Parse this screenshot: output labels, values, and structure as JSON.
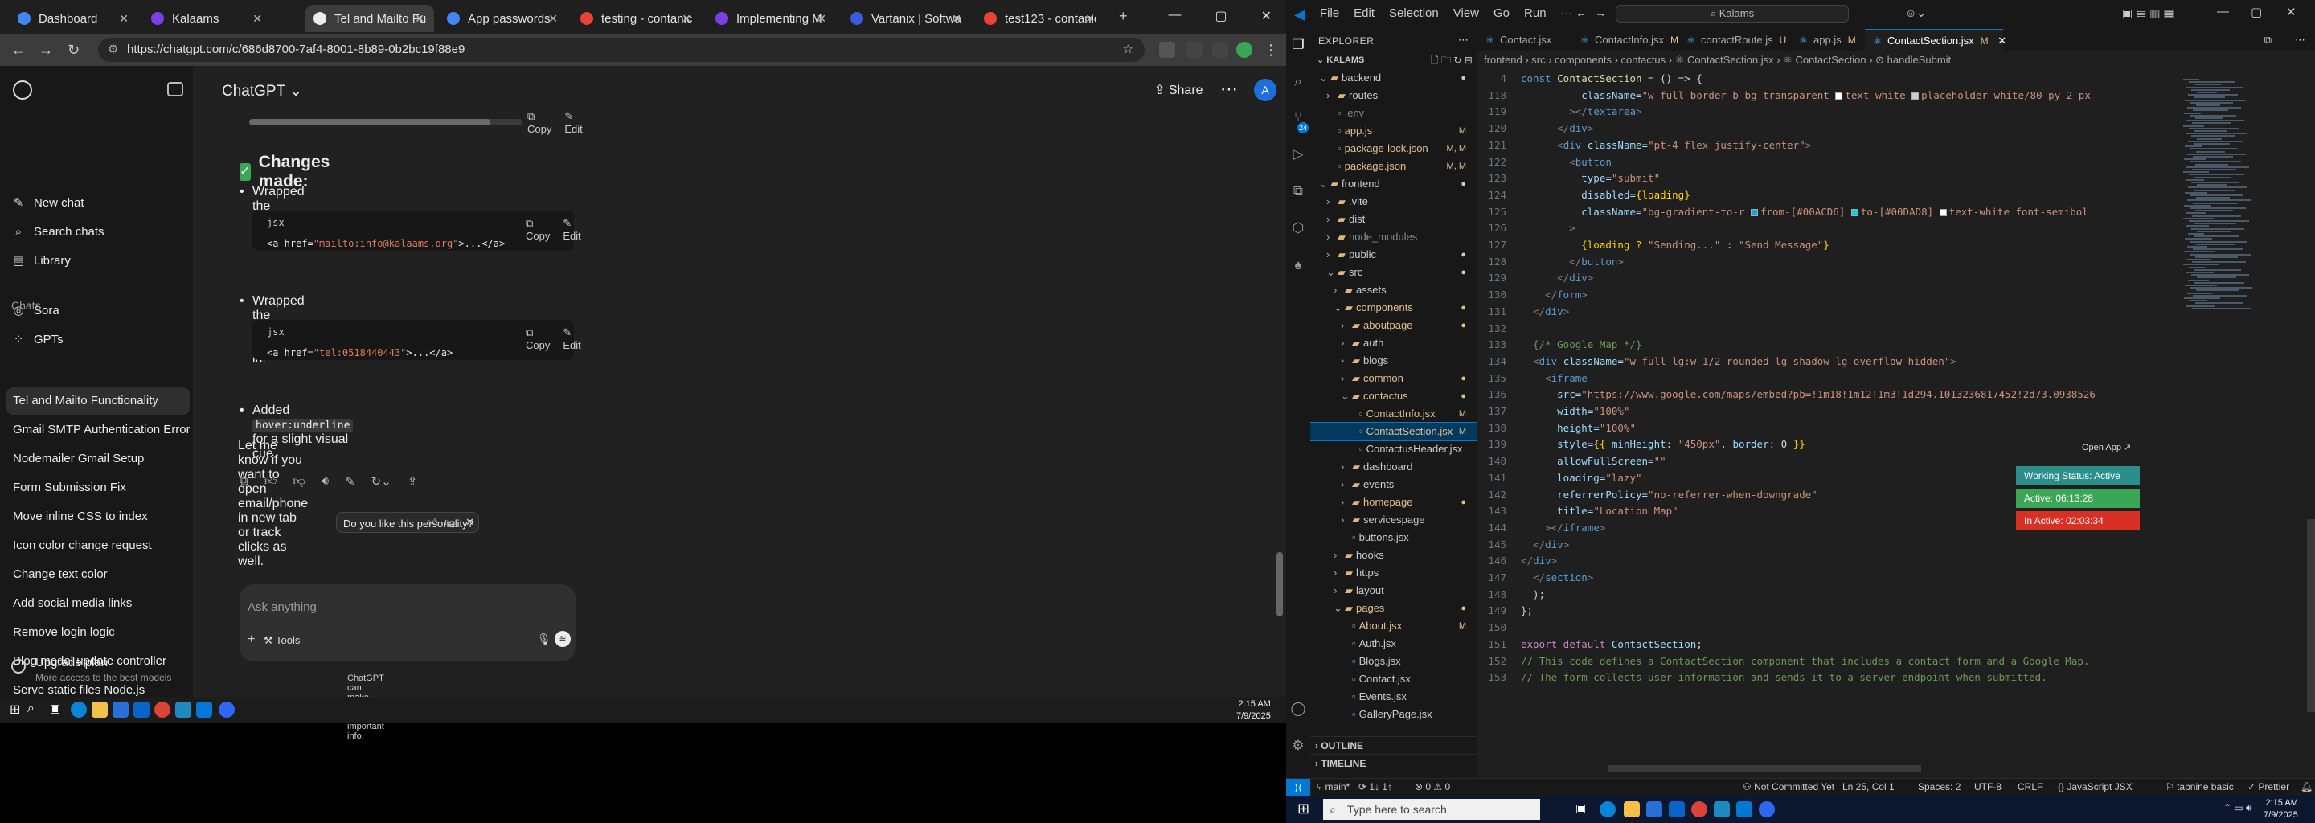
{
  "browser": {
    "tabs": [
      {
        "label": "Dashboard",
        "color": "#4285f4"
      },
      {
        "label": "Kalaams",
        "color": "#7b3fe4"
      },
      {
        "label": "Tel and Mailto Fu",
        "color": "#ececec"
      },
      {
        "label": "App passwords",
        "color": "#4285f4"
      },
      {
        "label": "testing - contanic",
        "color": "#ea4335"
      },
      {
        "label": "Implementing M",
        "color": "#7b3fe4"
      },
      {
        "label": "Vartanix | Softwa",
        "color": "#3b5bdb"
      },
      {
        "label": "test123 - contanic",
        "color": "#ea4335"
      }
    ],
    "url": "https://chatgpt.com/c/686d8700-7af4-8001-8b89-0b2bc19f88e9"
  },
  "chatgpt": {
    "sidebar": {
      "items": [
        {
          "icon": "✎",
          "label": "New chat"
        },
        {
          "icon": "⌕",
          "label": "Search chats"
        },
        {
          "icon": "▤",
          "label": "Library"
        },
        {
          "icon": "◎",
          "label": "Sora"
        },
        {
          "icon": "⁘",
          "label": "GPTs"
        }
      ],
      "chats_label": "Chats",
      "chats": [
        "Tel and Mailto Functionality",
        "Gmail SMTP Authentication Error",
        "Nodemailer Gmail Setup",
        "Form Submission Fix",
        "Move inline CSS to index",
        "Icon color change request",
        "Change text color",
        "Add social media links",
        "Remove login logic",
        "Blog model update controller",
        "Serve static files Node.js"
      ],
      "upgrade_title": "Upgrade plan",
      "upgrade_sub": "More access to the best models"
    },
    "header": {
      "model": "ChatGPT ⌄",
      "share": "Share",
      "avatar": "A"
    },
    "message": {
      "copy": "Copy",
      "edit": "Edit",
      "heading": "Changes made:",
      "bullet1": "Wrapped the email in:",
      "code1_lang": "jsx",
      "code1_pre": "<a href=",
      "code1_str": "\"mailto:info@kalaams.org\"",
      "code1_post": ">...</a>",
      "bullet2": "Wrapped the phone number in:",
      "code2_lang": "jsx",
      "code2_pre": "<a href=",
      "code2_str": "\"tel:0518440443\"",
      "code2_post": ">...</a>",
      "bullet3_pre": "Added",
      "bullet3_code": "hover:underline",
      "bullet3_post": "for a slight visual cue.",
      "closing": "Let me know if you want to open email/phone in new tab or track clicks as well."
    },
    "feedback_q": "Do you like this personality?",
    "composer": {
      "placeholder": "Ask anything",
      "tools": "Tools"
    },
    "disclaimer": "ChatGPT can make mistakes. Check important info."
  },
  "taskbar_left": {
    "time": "2:15 AM",
    "date": "7/9/2025"
  },
  "vscode": {
    "menu": [
      "File",
      "Edit",
      "Selection",
      "View",
      "Go",
      "Run",
      "···"
    ],
    "search": "Kalams",
    "explorer_title": "EXPLORER",
    "root": "KALAMS",
    "tree": [
      {
        "label": "backend",
        "indent": 1,
        "folder": true,
        "open": true,
        "color": "#ccc",
        "dec": "●"
      },
      {
        "label": "routes",
        "indent": 2,
        "folder": true,
        "open": false,
        "color": "#ccc",
        "dec": ""
      },
      {
        "label": ".env",
        "indent": 2,
        "folder": false,
        "color": "#8a8a8a",
        "dec": ""
      },
      {
        "label": "app.js",
        "indent": 2,
        "folder": false,
        "color": "#e2c08d",
        "dec": "M"
      },
      {
        "label": "package-lock.json",
        "indent": 2,
        "folder": false,
        "color": "#e2c08d",
        "dec": "M, M"
      },
      {
        "label": "package.json",
        "indent": 2,
        "folder": false,
        "color": "#e2c08d",
        "dec": "M, M"
      },
      {
        "label": "frontend",
        "indent": 1,
        "folder": true,
        "open": true,
        "color": "#ccc",
        "dec": "●"
      },
      {
        "label": ".vite",
        "indent": 2,
        "folder": true,
        "open": false,
        "color": "#ccc",
        "dec": ""
      },
      {
        "label": "dist",
        "indent": 2,
        "folder": true,
        "open": false,
        "color": "#ccc",
        "dec": ""
      },
      {
        "label": "node_modules",
        "indent": 2,
        "folder": true,
        "open": false,
        "color": "#8a8a8a",
        "dec": ""
      },
      {
        "label": "public",
        "indent": 2,
        "folder": true,
        "open": false,
        "color": "#ccc",
        "dec": "●"
      },
      {
        "label": "src",
        "indent": 2,
        "folder": true,
        "open": true,
        "color": "#ccc",
        "dec": "●"
      },
      {
        "label": "assets",
        "indent": 3,
        "folder": true,
        "open": false,
        "color": "#ccc",
        "dec": ""
      },
      {
        "label": "components",
        "indent": 3,
        "folder": true,
        "open": true,
        "color": "#e2c08d",
        "dec": "●"
      },
      {
        "label": "aboutpage",
        "indent": 4,
        "folder": true,
        "open": false,
        "color": "#e2c08d",
        "dec": "●"
      },
      {
        "label": "auth",
        "indent": 4,
        "folder": true,
        "open": false,
        "color": "#ccc",
        "dec": ""
      },
      {
        "label": "blogs",
        "indent": 4,
        "folder": true,
        "open": false,
        "color": "#ccc",
        "dec": ""
      },
      {
        "label": "common",
        "indent": 4,
        "folder": true,
        "open": false,
        "color": "#e2c08d",
        "dec": "●"
      },
      {
        "label": "contactus",
        "indent": 4,
        "folder": true,
        "open": true,
        "color": "#e2c08d",
        "dec": "●"
      },
      {
        "label": "ContactInfo.jsx",
        "indent": 5,
        "folder": false,
        "color": "#e2c08d",
        "dec": "M"
      },
      {
        "label": "ContactSection.jsx",
        "indent": 5,
        "folder": false,
        "color": "#e2c08d",
        "dec": "M",
        "sel": true
      },
      {
        "label": "ContactusHeader.jsx",
        "indent": 5,
        "folder": false,
        "color": "#ccc",
        "dec": ""
      },
      {
        "label": "dashboard",
        "indent": 4,
        "folder": true,
        "open": false,
        "color": "#ccc",
        "dec": ""
      },
      {
        "label": "events",
        "indent": 4,
        "folder": true,
        "open": false,
        "color": "#ccc",
        "dec": ""
      },
      {
        "label": "homepage",
        "indent": 4,
        "folder": true,
        "open": false,
        "color": "#e2c08d",
        "dec": "●"
      },
      {
        "label": "servicespage",
        "indent": 4,
        "folder": true,
        "open": false,
        "color": "#ccc",
        "dec": ""
      },
      {
        "label": "buttons.jsx",
        "indent": 4,
        "folder": false,
        "color": "#ccc",
        "dec": ""
      },
      {
        "label": "hooks",
        "indent": 3,
        "folder": true,
        "open": false,
        "color": "#ccc",
        "dec": ""
      },
      {
        "label": "https",
        "indent": 3,
        "folder": true,
        "open": false,
        "color": "#ccc",
        "dec": ""
      },
      {
        "label": "layout",
        "indent": 3,
        "folder": true,
        "open": false,
        "color": "#ccc",
        "dec": ""
      },
      {
        "label": "pages",
        "indent": 3,
        "folder": true,
        "open": true,
        "color": "#e2c08d",
        "dec": "●"
      },
      {
        "label": "About.jsx",
        "indent": 4,
        "folder": false,
        "color": "#e2c08d",
        "dec": "M"
      },
      {
        "label": "Auth.jsx",
        "indent": 4,
        "folder": false,
        "color": "#ccc",
        "dec": ""
      },
      {
        "label": "Blogs.jsx",
        "indent": 4,
        "folder": false,
        "color": "#ccc",
        "dec": ""
      },
      {
        "label": "Contact.jsx",
        "indent": 4,
        "folder": false,
        "color": "#ccc",
        "dec": ""
      },
      {
        "label": "Events.jsx",
        "indent": 4,
        "folder": false,
        "color": "#ccc",
        "dec": ""
      },
      {
        "label": "GalleryPage.jsx",
        "indent": 4,
        "folder": false,
        "color": "#ccc",
        "dec": ""
      }
    ],
    "outline": "OUTLINE",
    "timeline": "TIMELINE",
    "editor_tabs": [
      {
        "label": "Contact.jsx",
        "mod": ""
      },
      {
        "label": "ContactInfo.jsx",
        "mod": "M"
      },
      {
        "label": "contactRoute.js",
        "mod": "U"
      },
      {
        "label": "app.js",
        "mod": "M"
      },
      {
        "label": "ContactSection.jsx",
        "mod": "M",
        "active": true
      }
    ],
    "breadcrumb": "frontend  ›  src  ›  components  ›  contactus  ›  ⚛ ContactSection.jsx  ›  ⚛ ContactSection  ›  ⊙ handleSubmit",
    "lines": [
      [
        [
          "4",
          "ln"
        ],
        [
          "const ",
          "k"
        ],
        [
          "ContactSection",
          "f"
        ],
        [
          " = () => {",
          "w"
        ]
      ],
      [
        [
          "118",
          "ln"
        ],
        [
          "          className=",
          "at"
        ],
        [
          "\"w-full border-b bg-transparent ",
          "s"
        ],
        [
          "▢",
          "sw:#ffffff"
        ],
        [
          "text-white ",
          "s"
        ],
        [
          "▢",
          "sw:#cccccc"
        ],
        [
          "placeholder-white/80 py-2 px",
          "s"
        ]
      ],
      [
        [
          "119",
          "ln"
        ],
        [
          "        ></",
          "p"
        ],
        [
          "textarea",
          "k"
        ],
        [
          ">",
          "p"
        ]
      ],
      [
        [
          "120",
          "ln"
        ],
        [
          "      </",
          "p"
        ],
        [
          "div",
          "k"
        ],
        [
          ">",
          "p"
        ]
      ],
      [
        [
          "121",
          "ln"
        ],
        [
          "      <",
          "p"
        ],
        [
          "div ",
          "k"
        ],
        [
          "className=",
          "at"
        ],
        [
          "\"pt-4 flex justify-center\"",
          "s"
        ],
        [
          ">",
          "p"
        ]
      ],
      [
        [
          "122",
          "ln"
        ],
        [
          "        <",
          "p"
        ],
        [
          "button",
          "k"
        ]
      ],
      [
        [
          "123",
          "ln"
        ],
        [
          "          type=",
          "at"
        ],
        [
          "\"submit\"",
          "s"
        ]
      ],
      [
        [
          "124",
          "ln"
        ],
        [
          "          disabled=",
          "at"
        ],
        [
          "{loading}",
          "b"
        ]
      ],
      [
        [
          "125",
          "ln"
        ],
        [
          "          className=",
          "at"
        ],
        [
          "\"bg-gradient-to-r ",
          "s"
        ],
        [
          "▢",
          "sw:#00ACD6"
        ],
        [
          "from-[#00ACD6] ",
          "s"
        ],
        [
          "▢",
          "sw:#00DAD8"
        ],
        [
          "to-[#00DAD8] ",
          "s"
        ],
        [
          "▢",
          "sw:#ffffff"
        ],
        [
          "text-white font-semibol",
          "s"
        ]
      ],
      [
        [
          "126",
          "ln"
        ],
        [
          "        >",
          "p"
        ]
      ],
      [
        [
          "127",
          "ln"
        ],
        [
          "          {loading ? ",
          "b"
        ],
        [
          "\"Sending...\"",
          "s"
        ],
        [
          " : ",
          "w"
        ],
        [
          "\"Send Message\"",
          "s"
        ],
        [
          "}",
          "b"
        ]
      ],
      [
        [
          "128",
          "ln"
        ],
        [
          "        </",
          "p"
        ],
        [
          "button",
          "k"
        ],
        [
          ">",
          "p"
        ]
      ],
      [
        [
          "129",
          "ln"
        ],
        [
          "      </",
          "p"
        ],
        [
          "div",
          "k"
        ],
        [
          ">",
          "p"
        ]
      ],
      [
        [
          "130",
          "ln"
        ],
        [
          "    </",
          "p"
        ],
        [
          "form",
          "k"
        ],
        [
          ">",
          "p"
        ]
      ],
      [
        [
          "131",
          "ln"
        ],
        [
          "  </",
          "p"
        ],
        [
          "div",
          "k"
        ],
        [
          ">",
          "p"
        ]
      ],
      [
        [
          "132",
          "ln"
        ],
        [
          "",
          "w"
        ]
      ],
      [
        [
          "133",
          "ln"
        ],
        [
          "  {/* Google Map */}",
          "c"
        ]
      ],
      [
        [
          "134",
          "ln"
        ],
        [
          "  <",
          "p"
        ],
        [
          "div ",
          "k"
        ],
        [
          "className=",
          "at"
        ],
        [
          "\"w-full lg:w-1/2 rounded-lg shadow-lg overflow-hidden\"",
          "s"
        ],
        [
          ">",
          "p"
        ]
      ],
      [
        [
          "135",
          "ln"
        ],
        [
          "    <",
          "p"
        ],
        [
          "iframe",
          "k"
        ]
      ],
      [
        [
          "136",
          "ln"
        ],
        [
          "      src=",
          "at"
        ],
        [
          "\"https://www.google.com/maps/embed?pb=!1m18!1m12!1m3!1d294.1013236817452!2d73.0938526",
          "s"
        ]
      ],
      [
        [
          "137",
          "ln"
        ],
        [
          "      width=",
          "at"
        ],
        [
          "\"100%\"",
          "s"
        ]
      ],
      [
        [
          "138",
          "ln"
        ],
        [
          "      height=",
          "at"
        ],
        [
          "\"100%\"",
          "s"
        ]
      ],
      [
        [
          "139",
          "ln"
        ],
        [
          "      style=",
          "at"
        ],
        [
          "{{ ",
          "b"
        ],
        [
          "minHeight: ",
          "at"
        ],
        [
          "\"450px\"",
          "s"
        ],
        [
          ", ",
          "w"
        ],
        [
          "border: ",
          "at"
        ],
        [
          "0",
          "w"
        ],
        [
          " }}",
          "b"
        ]
      ],
      [
        [
          "140",
          "ln"
        ],
        [
          "      allowFullScreen=",
          "at"
        ],
        [
          "\"\"",
          "s"
        ]
      ],
      [
        [
          "141",
          "ln"
        ],
        [
          "      loading=",
          "at"
        ],
        [
          "\"lazy\"",
          "s"
        ]
      ],
      [
        [
          "142",
          "ln"
        ],
        [
          "      referrerPolicy=",
          "at"
        ],
        [
          "\"no-referrer-when-downgrade\"",
          "s"
        ]
      ],
      [
        [
          "143",
          "ln"
        ],
        [
          "      title=",
          "at"
        ],
        [
          "\"Location Map\"",
          "s"
        ]
      ],
      [
        [
          "144",
          "ln"
        ],
        [
          "    ></",
          "p"
        ],
        [
          "iframe",
          "k"
        ],
        [
          ">",
          "p"
        ]
      ],
      [
        [
          "145",
          "ln"
        ],
        [
          "  </",
          "p"
        ],
        [
          "div",
          "k"
        ],
        [
          ">",
          "p"
        ]
      ],
      [
        [
          "146",
          "ln"
        ],
        [
          "</",
          "p"
        ],
        [
          "div",
          "k"
        ],
        [
          ">",
          "p"
        ]
      ],
      [
        [
          "147",
          "ln"
        ],
        [
          "  </",
          "p"
        ],
        [
          "section",
          "k"
        ],
        [
          ">",
          "p"
        ]
      ],
      [
        [
          "148",
          "ln"
        ],
        [
          "  );",
          "w"
        ]
      ],
      [
        [
          "149",
          "ln"
        ],
        [
          "};",
          "w"
        ]
      ],
      [
        [
          "150",
          "ln"
        ],
        [
          "",
          "w"
        ]
      ],
      [
        [
          "151",
          "ln"
        ],
        [
          "export default ",
          "k2"
        ],
        [
          "ContactSection",
          "at"
        ],
        [
          ";",
          "w"
        ]
      ],
      [
        [
          "152",
          "ln"
        ],
        [
          "// This code defines a ContactSection component that includes a contact form and a Google Map.",
          "c"
        ]
      ],
      [
        [
          "153",
          "ln"
        ],
        [
          "// The form collects user information and sends it to a server endpoint when submitted.",
          "c"
        ]
      ]
    ],
    "tracker": {
      "open_app": "Open App ↗",
      "working": "Working Status: Active",
      "active": "Active: 06:13:28",
      "inactive": "In Active: 02:03:34",
      "working_color": "#2a8f8a",
      "active_color": "#3aa757",
      "inactive_color": "#d93025"
    },
    "status": {
      "branch": "main*",
      "sync": "⟳ 1↓ 1↑",
      "problems": "⊗ 0 ⚠ 0",
      "commit": "Not Committed Yet",
      "position": "Ln 25, Col 1",
      "spaces": "Spaces: 2",
      "encoding": "UTF-8",
      "eol": "CRLF",
      "language": "{} JavaScript JSX",
      "tabnine": "tabnine basic",
      "prettier": "✓ Prettier"
    },
    "taskbar": {
      "search_placeholder": "Type here to search",
      "time": "2:15 AM",
      "date": "7/9/2025"
    }
  }
}
